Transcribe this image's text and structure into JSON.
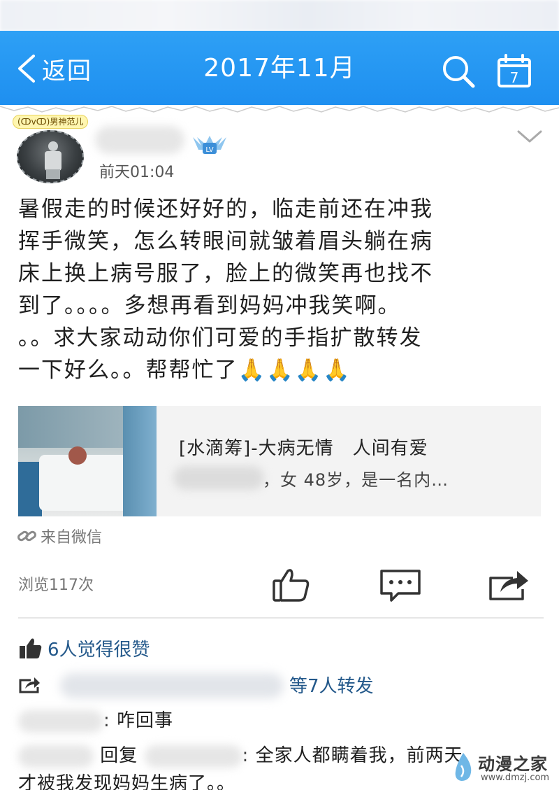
{
  "navbar": {
    "back_label": "返回",
    "title": "2017年11月",
    "calendar_day": "7",
    "color": "#2496f2"
  },
  "post": {
    "avatar_badge": "(ↀvↀ)男神范儿",
    "time": "前天01:04",
    "level_badge": "LV",
    "text_lines": [
      "暑假走的时候还好好的，临走前还在冲我",
      "挥手微笑，怎么转眼间就皱着眉头躺在病",
      "床上换上病号服了，脸上的微笑再也找不",
      "到了。。。。多想再看到妈妈冲我笑啊。",
      "。。求大家动动你们可爱的手指扩散转发",
      "一下好么。。帮帮忙了"
    ],
    "emoji": "🙏🙏🙏🙏"
  },
  "link_card": {
    "title": "[水滴筹]-大病无情　人间有爱",
    "desc": "，女 48岁，是一名内…"
  },
  "source": {
    "label": "来自微信"
  },
  "stats": {
    "views": "浏览117次"
  },
  "likes": {
    "text": "6人觉得很赞"
  },
  "forwards": {
    "text": "等7人转发"
  },
  "comments": [
    {
      "text": ": 咋回事"
    },
    {
      "reply_label": "回复",
      "text": ": 全家人都瞒着我，前两天",
      "text_line2": "才被我发现妈妈生病了。。"
    }
  ],
  "watermark": {
    "title": "动漫之家",
    "url": "www.dmzj.com"
  },
  "colors": {
    "accent_blue": "#2496f2",
    "link_text": "#23588a",
    "muted": "#777777"
  }
}
